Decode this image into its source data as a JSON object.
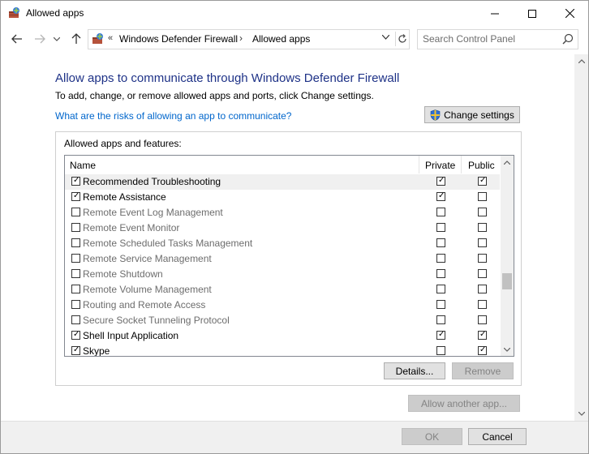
{
  "window": {
    "title": "Allowed apps",
    "minimize_icon": "minimize-icon",
    "maximize_icon": "maximize-icon",
    "close_icon": "close-icon"
  },
  "addressbar": {
    "overflow_chevron": "«",
    "crumbs": [
      "Windows Defender Firewall",
      "Allowed apps"
    ],
    "separator": "›"
  },
  "search": {
    "placeholder": "Search Control Panel"
  },
  "main": {
    "heading": "Allow apps to communicate through Windows Defender Firewall",
    "subtext": "To add, change, or remove allowed apps and ports, click Change settings.",
    "risk_link": "What are the risks of allowing an app to communicate?",
    "change_settings": "Change settings"
  },
  "group": {
    "label": "Allowed apps and features:",
    "columns": {
      "name": "Name",
      "private": "Private",
      "public": "Public"
    },
    "rows": [
      {
        "name": "Recommended Troubleshooting",
        "enabled": true,
        "private": true,
        "public": true,
        "selected": true
      },
      {
        "name": "Remote Assistance",
        "enabled": true,
        "private": true,
        "public": false,
        "selected": false
      },
      {
        "name": "Remote Event Log Management",
        "enabled": false,
        "private": false,
        "public": false,
        "selected": false
      },
      {
        "name": "Remote Event Monitor",
        "enabled": false,
        "private": false,
        "public": false,
        "selected": false
      },
      {
        "name": "Remote Scheduled Tasks Management",
        "enabled": false,
        "private": false,
        "public": false,
        "selected": false
      },
      {
        "name": "Remote Service Management",
        "enabled": false,
        "private": false,
        "public": false,
        "selected": false
      },
      {
        "name": "Remote Shutdown",
        "enabled": false,
        "private": false,
        "public": false,
        "selected": false
      },
      {
        "name": "Remote Volume Management",
        "enabled": false,
        "private": false,
        "public": false,
        "selected": false
      },
      {
        "name": "Routing and Remote Access",
        "enabled": false,
        "private": false,
        "public": false,
        "selected": false
      },
      {
        "name": "Secure Socket Tunneling Protocol",
        "enabled": false,
        "private": false,
        "public": false,
        "selected": false
      },
      {
        "name": "Shell Input Application",
        "enabled": true,
        "private": true,
        "public": true,
        "selected": false
      },
      {
        "name": "Skype",
        "enabled": true,
        "private": false,
        "public": true,
        "selected": false
      }
    ],
    "details": "Details...",
    "remove": "Remove"
  },
  "allow_another": "Allow another app...",
  "footer": {
    "ok": "OK",
    "cancel": "Cancel"
  },
  "colors": {
    "heading": "#1e3287",
    "link": "#0066cc",
    "disabled_text": "#838383"
  }
}
